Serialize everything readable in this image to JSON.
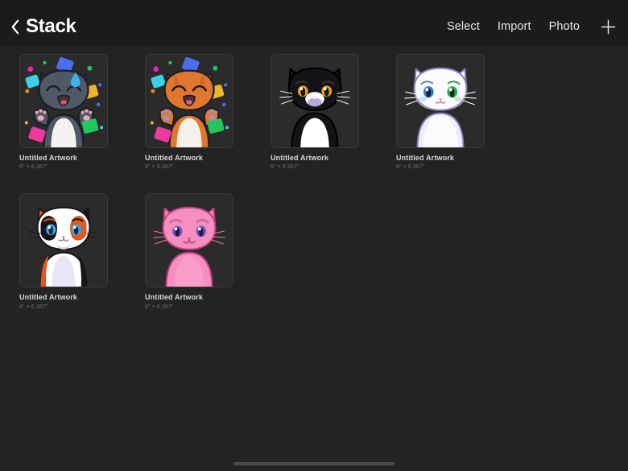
{
  "window": {
    "title": "Stack"
  },
  "navbar": {
    "back_icon": "chevron-left-icon",
    "title": "Stack",
    "actions": [
      {
        "label": "Select",
        "name": "select-button"
      },
      {
        "label": "Import",
        "name": "import-button"
      },
      {
        "label": "Photo",
        "name": "photo-button"
      }
    ],
    "add_icon": "plus-icon"
  },
  "artworks": [
    {
      "title": "Untitled Artwork",
      "size": "6\" × 6.367\"",
      "art": "gray-cat-confetti",
      "colors": {
        "body": "#4e5866",
        "body_dark": "#3c4450",
        "belly": "#f3f2f0",
        "ear_inner": "#f0a7b8",
        "paw_pad": "#f0a7b8",
        "mouth": "#5c2b38",
        "tongue": "#c95a74",
        "outline": "#1c1f26"
      }
    },
    {
      "title": "Untitled Artwork",
      "size": "6\" × 6.367\"",
      "art": "orange-cat-confetti",
      "colors": {
        "body": "#e1762e",
        "body_dark": "#c55f20",
        "belly": "#f5f1ea",
        "ear_inner": "#a8a0c8",
        "paw_pad": "#a88fb8",
        "mouth": "#5c2b38",
        "tongue": "#d36a80",
        "outline": "#1c1f26"
      }
    },
    {
      "title": "Untitled Artwork",
      "size": "6\" × 6.367\"",
      "art": "black-tuxedo-cat",
      "colors": {
        "body": "#141418",
        "body_dark": "#0b0b0e",
        "belly": "#ffffff",
        "ear_inner": "#c79cb0",
        "eye": "#e8a020",
        "nose": "#b9a8d8",
        "outline": "#000000"
      }
    },
    {
      "title": "Untitled Artwork",
      "size": "6\" × 6.367\"",
      "art": "white-cat-heterochromia",
      "colors": {
        "body": "#fbfbfd",
        "body_dark": "#ddd8ee",
        "ear_inner": "#b89aa8",
        "eye_left": "#2d7fd4",
        "eye_right": "#2fa84f",
        "outline": "#8f7fb8"
      }
    },
    {
      "title": "Untitled Artwork",
      "size": "6\" × 6.367\"",
      "art": "calico-cat",
      "colors": {
        "body": "#ffffff",
        "patch_orange": "#e4571d",
        "patch_black": "#16151a",
        "eye": "#3aa9e8",
        "shadow": "#ddd6ef",
        "outline": "#16151a"
      }
    },
    {
      "title": "Untitled Artwork",
      "size": "6\" × 6.367\"",
      "art": "pink-cat",
      "colors": {
        "body": "#f58fc0",
        "body_dark": "#e06aa8",
        "ear_inner": "#c98098",
        "eye": "#6f4fc0",
        "outline": "#c0407f"
      }
    }
  ],
  "confetti": {
    "magenta": "#e526b0",
    "green": "#22c55e",
    "blue": "#4a6ef0",
    "cyan": "#3fd0e8",
    "yellow": "#f0b429",
    "orange": "#f08a1e",
    "pink": "#f0399e",
    "teal": "#1ec8b0",
    "droplet": "#3fb0f0"
  },
  "home_indicator": {
    "name": "home-indicator"
  }
}
